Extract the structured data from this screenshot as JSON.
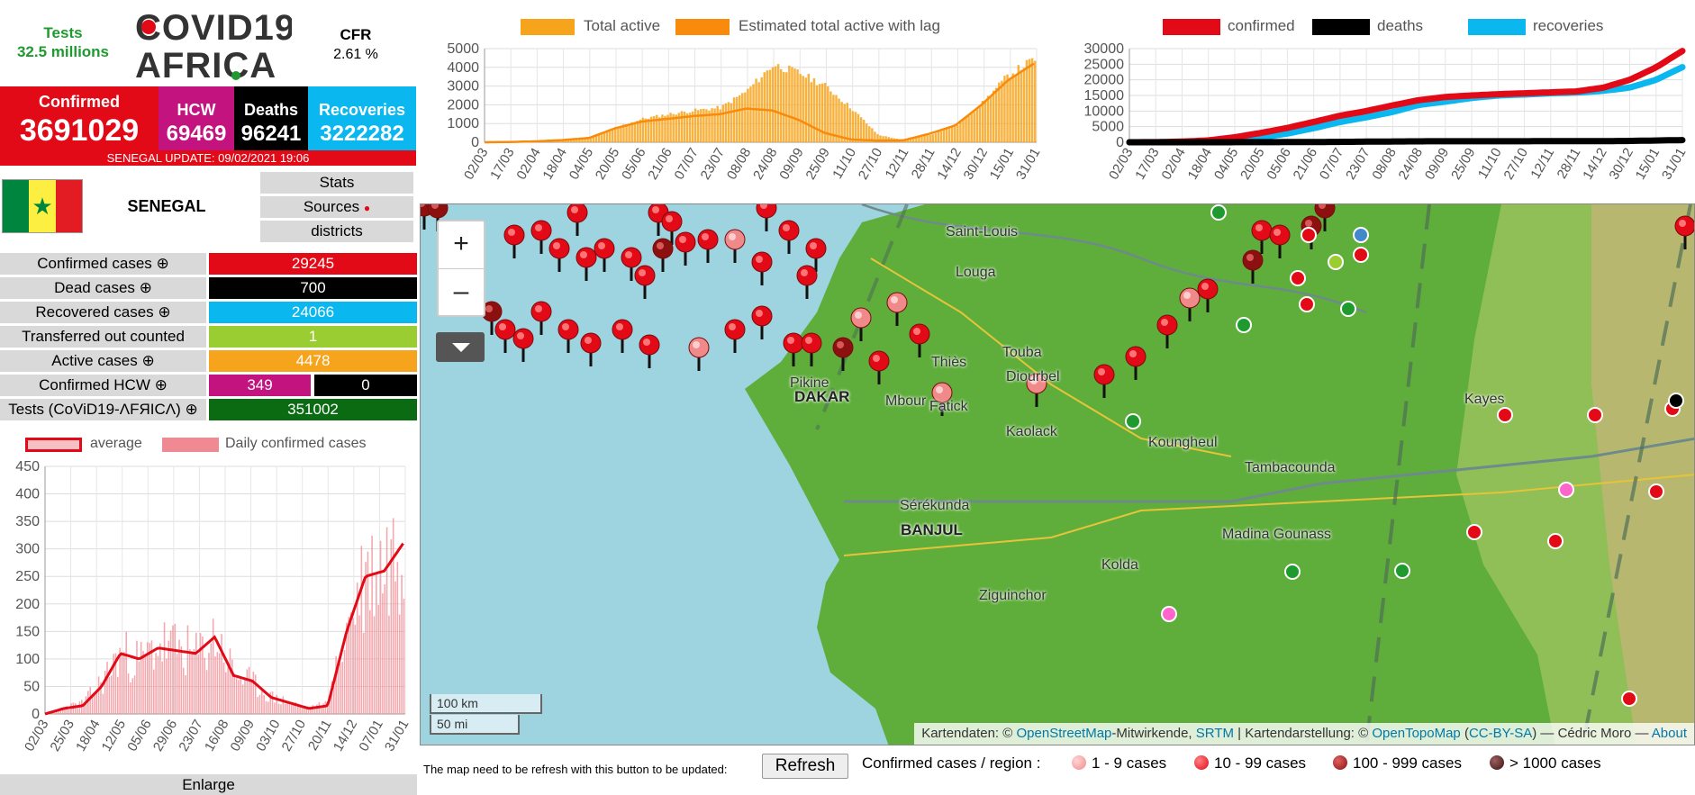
{
  "header": {
    "tests_label": "Tests",
    "tests_value": "32.5 millions",
    "cfr_label": "CFR",
    "cfr_value": "2.61 %",
    "logo_top": "COVID19",
    "logo_bottom": "AFRICA"
  },
  "kpis": {
    "confirmed_label": "Confirmed",
    "confirmed_value": "3691029",
    "hcw_label": "HCW",
    "hcw_value": "69469",
    "deaths_label": "Deaths",
    "deaths_value": "96241",
    "recoveries_label": "Recoveries",
    "recoveries_value": "3222282",
    "update_text": "SENEGAL UPDATE: 09/02/2021 19:06"
  },
  "country": {
    "name": "SENEGAL",
    "buttons": {
      "stats": "Stats",
      "sources": "Sources",
      "districts": "districts"
    }
  },
  "stats": {
    "confirmed_label": "Confirmed cases ⊕",
    "confirmed_value": "29245",
    "dead_label": "Dead cases ⊕",
    "dead_value": "700",
    "recovered_label": "Recovered cases ⊕",
    "recovered_value": "24066",
    "transferred_label": "Transferred out counted",
    "transferred_value": "1",
    "active_label": "Active cases ⊕",
    "active_value": "4478",
    "hcw_label": "Confirmed HCW ⊕",
    "hcw_value": "349",
    "hcw_deaths_value": "0",
    "tests_label": "Tests (CoViD19-ΛFЯICΛ) ⊕",
    "tests_value": "351002"
  },
  "colors": {
    "red": "#e20a17",
    "hcw": "#c2137f",
    "black": "#000000",
    "blue": "#0bb7ef",
    "green": "#9acd32",
    "orange": "#f7a41d",
    "dark_green": "#0b6b12"
  },
  "enlarge_label": "Enlarge",
  "map": {
    "zoom_in": "+",
    "zoom_out": "–",
    "scale_km": "100 km",
    "scale_mi": "50 mi",
    "attribution_pre": "Kartendaten: ©",
    "attribution_osm": "OpenStreetMap",
    "attribution_mid1": "-Mitwirkende,",
    "attribution_srtm": "SRTM",
    "attribution_mid2": "| Kartendarstellung: ©",
    "attribution_otm": "OpenTopoMap",
    "attribution_lic": "CC-BY-SA",
    "attribution_author": ") — Cédric Moro —",
    "attribution_about": "About",
    "cities": [
      "Saint-Louis",
      "Louga",
      "Thiès",
      "Touba",
      "Diourbel",
      "DAKAR",
      "Mbour",
      "Fatick",
      "Kaolack",
      "Koungheul",
      "Tambacounda",
      "Kayes",
      "Sérékunda",
      "BANJUL",
      "Madina Gounass",
      "Kolda",
      "Ziguinchor",
      "Pikine"
    ]
  },
  "footer": {
    "notice": "The map need to be refresh with this button to be updated:",
    "refresh": "Refresh",
    "legend_title": "Confirmed cases / region :",
    "legend_1": "1 - 9 cases",
    "legend_2": "10 - 99 cases",
    "legend_3": "100 - 999 cases",
    "legend_4": "> 1000 cases"
  },
  "chart_data": [
    {
      "type": "area",
      "title": "",
      "legend": [
        "Total active",
        "Estimated total active with lag"
      ],
      "legend_placement": "top",
      "ylim": [
        0,
        5000
      ],
      "yticks": [
        0,
        1000,
        2000,
        3000,
        4000,
        5000
      ],
      "xticks": [
        "02/03",
        "17/03",
        "02/04",
        "18/04",
        "04/05",
        "20/05",
        "05/06",
        "21/06",
        "07/07",
        "23/07",
        "08/08",
        "24/08",
        "09/09",
        "25/09",
        "11/10",
        "27/10",
        "12/11",
        "28/11",
        "14/12",
        "30/12",
        "15/01",
        "31/01"
      ],
      "grid": true,
      "series": [
        {
          "name": "Total active",
          "values": [
            0,
            20,
            60,
            130,
            250,
            800,
            1250,
            1500,
            1700,
            1850,
            2750,
            4150,
            3700,
            3000,
            1800,
            400,
            100,
            400,
            900,
            2100,
            3600,
            4450
          ],
          "color": "#f7a41d"
        },
        {
          "name": "Estimated total active with lag",
          "values": [
            0,
            15,
            50,
            120,
            230,
            750,
            1100,
            1250,
            1400,
            1500,
            1800,
            1700,
            1200,
            500,
            150,
            90,
            100,
            450,
            900,
            2000,
            3300,
            4200
          ],
          "color": "#f88a0c"
        }
      ]
    },
    {
      "type": "line",
      "title": "",
      "legend": [
        "confirmed",
        "deaths",
        "recoveries"
      ],
      "legend_placement": "top",
      "ylim": [
        0,
        30000
      ],
      "yticks": [
        0,
        5000,
        10000,
        15000,
        20000,
        25000,
        30000
      ],
      "xticks": [
        "02/03",
        "17/03",
        "02/04",
        "18/04",
        "04/05",
        "20/05",
        "05/06",
        "21/06",
        "07/07",
        "23/07",
        "08/08",
        "24/08",
        "09/09",
        "25/09",
        "11/10",
        "27/10",
        "12/11",
        "28/11",
        "14/12",
        "30/12",
        "15/01",
        "31/01"
      ],
      "grid": true,
      "series": [
        {
          "name": "confirmed",
          "values": [
            0,
            30,
            200,
            600,
            1600,
            3000,
            4600,
            6500,
            8500,
            10000,
            11800,
            13500,
            14500,
            15000,
            15400,
            15700,
            16000,
            16300,
            17500,
            20000,
            24000,
            29245
          ],
          "color": "#e20a17"
        },
        {
          "name": "deaths",
          "values": [
            0,
            0,
            2,
            6,
            15,
            30,
            50,
            80,
            130,
            190,
            250,
            300,
            310,
            315,
            320,
            330,
            335,
            345,
            370,
            420,
            560,
            700
          ],
          "color": "#000000"
        },
        {
          "name": "recoveries",
          "values": [
            0,
            5,
            100,
            300,
            700,
            1500,
            2800,
            4500,
            6500,
            8000,
            9700,
            12000,
            13000,
            14200,
            15000,
            15300,
            15700,
            15900,
            16500,
            17500,
            20000,
            24066
          ],
          "color": "#0bb7ef"
        }
      ]
    },
    {
      "type": "bar",
      "title": "",
      "legend": [
        "average",
        "Daily confirmed cases"
      ],
      "legend_placement": "top",
      "ylim": [
        0,
        450
      ],
      "yticks": [
        0,
        50,
        100,
        150,
        200,
        250,
        300,
        350,
        400,
        450
      ],
      "xticks": [
        "02/03",
        "25/03",
        "18/04",
        "12/05",
        "05/06",
        "29/06",
        "23/07",
        "16/08",
        "09/09",
        "03/10",
        "27/10",
        "20/11",
        "14/12",
        "07/01",
        "31/01"
      ],
      "grid": true,
      "series": [
        {
          "name": "average",
          "values": [
            0,
            10,
            15,
            50,
            110,
            100,
            120,
            115,
            110,
            140,
            70,
            60,
            30,
            20,
            10,
            15,
            150,
            250,
            260,
            310
          ],
          "color": "#e20a17"
        },
        {
          "name": "Daily confirmed cases",
          "values": [
            0,
            12,
            20,
            60,
            110,
            95,
            125,
            120,
            105,
            140,
            75,
            55,
            30,
            20,
            10,
            20,
            160,
            255,
            270,
            330
          ],
          "color": "#f08a92"
        }
      ]
    }
  ]
}
